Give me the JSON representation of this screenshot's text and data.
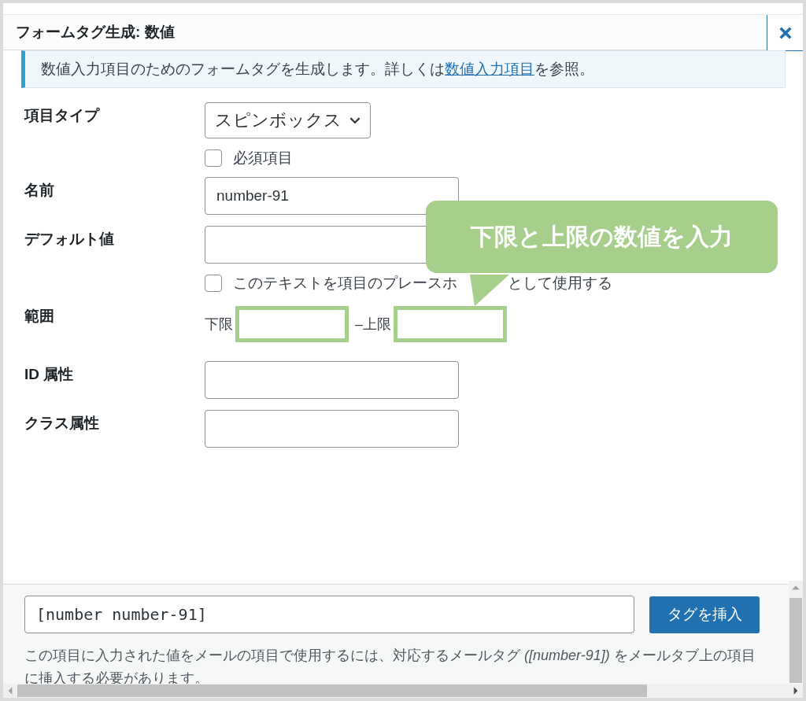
{
  "dialog": {
    "title": "フォームタグ生成: 数値"
  },
  "notice": {
    "text": "数値入力項目のためのフォームタグを生成します。詳しくは",
    "link": "数値入力項目",
    "text_after": "を参照。"
  },
  "rows": [
    {
      "kind": "select",
      "label": "項目タイプ",
      "value": "スピンボックス",
      "checkbox": {
        "label_parts": [
          "必須項目"
        ],
        "checked": false
      }
    },
    {
      "kind": "text",
      "label": "名前",
      "value": "number-91"
    },
    {
      "kind": "text",
      "label": "デフォルト値",
      "checkbox": {
        "label_parts": [
          "このテキストを項目のプレースホ",
          "として使用する"
        ],
        "checked": false
      }
    },
    {
      "kind": "range",
      "label": "範囲",
      "min_label": "下限",
      "separator": "–",
      "max_label": "上限",
      "highlighted": true
    },
    {
      "kind": "text",
      "label": "ID 属性"
    },
    {
      "kind": "text",
      "label": "クラス属性"
    }
  ],
  "callout": {
    "text": "下限と上限の数値を入力"
  },
  "footer": {
    "tag": "[number number-91]",
    "button": "タグを挿入",
    "note": "この項目に入力された値をメールの項目で使用するには、対応するメールタグ *([number-91])* をメールタブ上の項目に挿入する必要があります。"
  }
}
